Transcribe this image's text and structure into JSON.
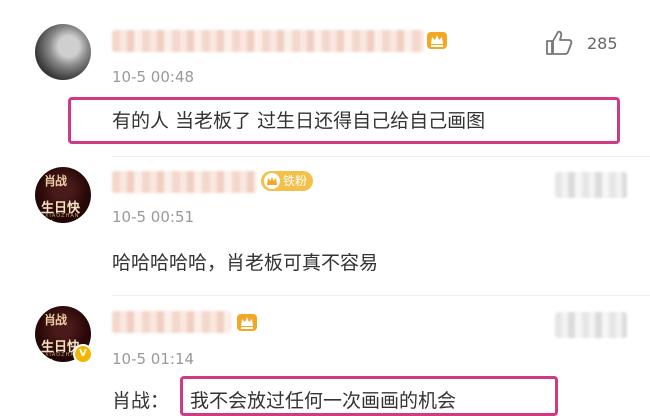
{
  "comments": [
    {
      "time": "10-5 00:48",
      "text": "有的人 当老板了 过生日还得自己给自己画图",
      "likes": "285"
    },
    {
      "avatar_text": [
        "肖战",
        "生日快乐",
        "XIAOZHAN"
      ],
      "badge": "铁粉",
      "time": "10-5 00:51",
      "text": "哈哈哈哈哈，肖老板可真不容易"
    },
    {
      "avatar_text": [
        "肖战",
        "生日快乐",
        "XIAOZHAN"
      ],
      "time": "10-5 01:14",
      "prefix": "肖战：",
      "text": "我不会放过任何一次画画的机会"
    }
  ],
  "colors": {
    "highlight": "#d13a83",
    "crown": "#f3a825",
    "badge": "#f3c04a"
  }
}
